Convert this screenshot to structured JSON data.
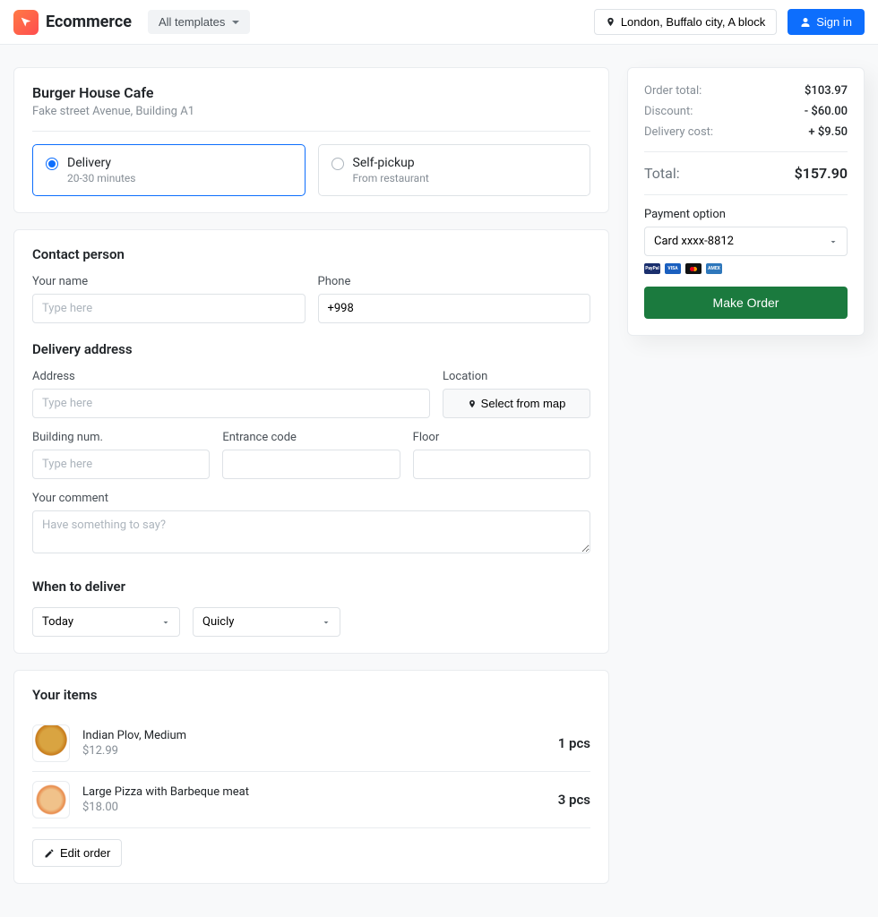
{
  "brand": {
    "name": "Ecommerce"
  },
  "header": {
    "all_templates": "All templates",
    "location": "London, Buffalo city, A block",
    "signin": "Sign in"
  },
  "vendor": {
    "name": "Burger House Cafe",
    "address": "Fake street Avenue, Building A1"
  },
  "delivery_options": {
    "delivery": {
      "label": "Delivery",
      "sub": "20-30 minutes"
    },
    "pickup": {
      "label": "Self-pickup",
      "sub": "From restaurant"
    }
  },
  "sections": {
    "contact_title": "Contact person",
    "name_label": "Your name",
    "name_placeholder": "Type here",
    "phone_label": "Phone",
    "phone_value": "+998",
    "delivery_title": "Delivery address",
    "address_label": "Address",
    "address_placeholder": "Type here",
    "location_label": "Location",
    "select_map_btn": "Select from map",
    "building_label": "Building num.",
    "building_placeholder": "Type here",
    "entrance_label": "Entrance code",
    "floor_label": "Floor",
    "comment_label": "Your comment",
    "comment_placeholder": "Have something to say?",
    "when_title": "When to deliver",
    "when_day": "Today",
    "when_time": "Quicly"
  },
  "items": {
    "title": "Your items",
    "list": [
      {
        "name": "Indian Plov, Medium",
        "price": "$12.99",
        "qty": "1 pcs"
      },
      {
        "name": "Large Pizza with Barbeque meat",
        "price": "$18.00",
        "qty": "3 pcs"
      }
    ],
    "edit": "Edit order"
  },
  "summary": {
    "order_total_label": "Order total:",
    "order_total_value": "$103.97",
    "discount_label": "Discount:",
    "discount_value": "- $60.00",
    "delivery_label": "Delivery cost:",
    "delivery_value": "+ $9.50",
    "total_label": "Total:",
    "total_value": "$157.90",
    "payment_label": "Payment option",
    "payment_selected": "Card xxxx-8812",
    "make_order": "Make Order"
  }
}
